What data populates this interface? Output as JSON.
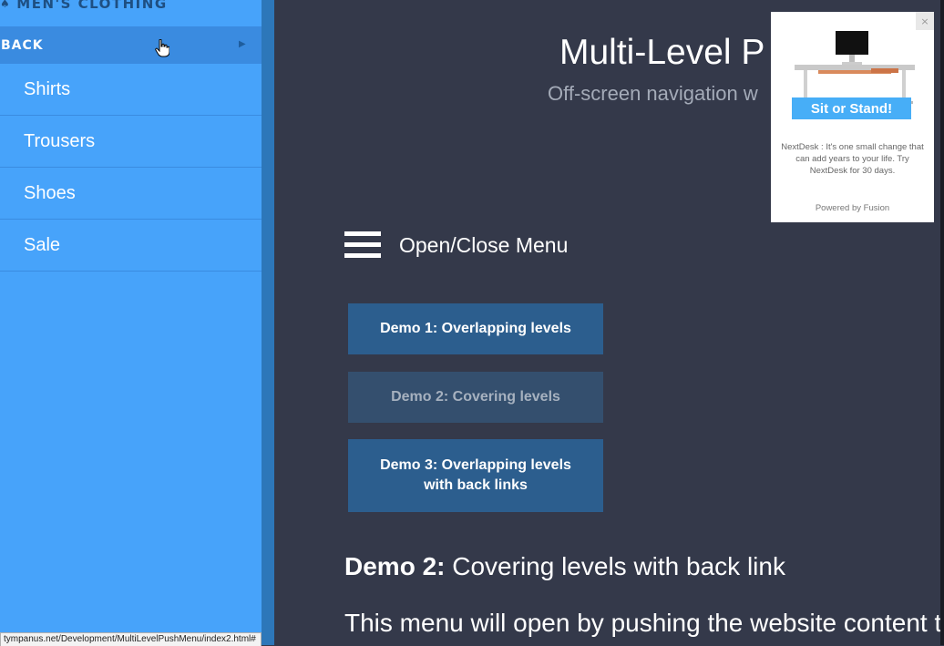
{
  "sidebar": {
    "title": "MEN'S CLOTHING",
    "back_label": "BACK",
    "items": [
      {
        "label": "Shirts"
      },
      {
        "label": "Trousers"
      },
      {
        "label": "Shoes"
      },
      {
        "label": "Sale"
      }
    ]
  },
  "header": {
    "title": "Multi-Level P",
    "subtitle": "Off-screen navigation w"
  },
  "menu_toggle": {
    "label": "Open/Close Menu",
    "icon": "hamburger-icon"
  },
  "demos": [
    {
      "label": "Demo 1: Overlapping levels"
    },
    {
      "label": "Demo 2: Covering levels",
      "active": true
    },
    {
      "label": "Demo 3: Overlapping levels with back links"
    }
  ],
  "section": {
    "heading_bold": "Demo 2:",
    "heading_rest": " Covering levels with back link",
    "intro": "This menu will open by pushing the website content t"
  },
  "ad": {
    "cta": "Sit or Stand!",
    "text": "NextDesk : It's one small change that can add years to your life. Try NextDesk for 30 days.",
    "powered_by": "Powered by Fusion"
  },
  "status_bar": {
    "url": "tympanus.net/Development/MultiLevelPushMenu/index2.html#"
  },
  "colors": {
    "menu_bg": "#47a3fa",
    "page_bg": "#34394a",
    "button_bg": "#2c5e8e",
    "button_active_bg": "#344f6e"
  }
}
